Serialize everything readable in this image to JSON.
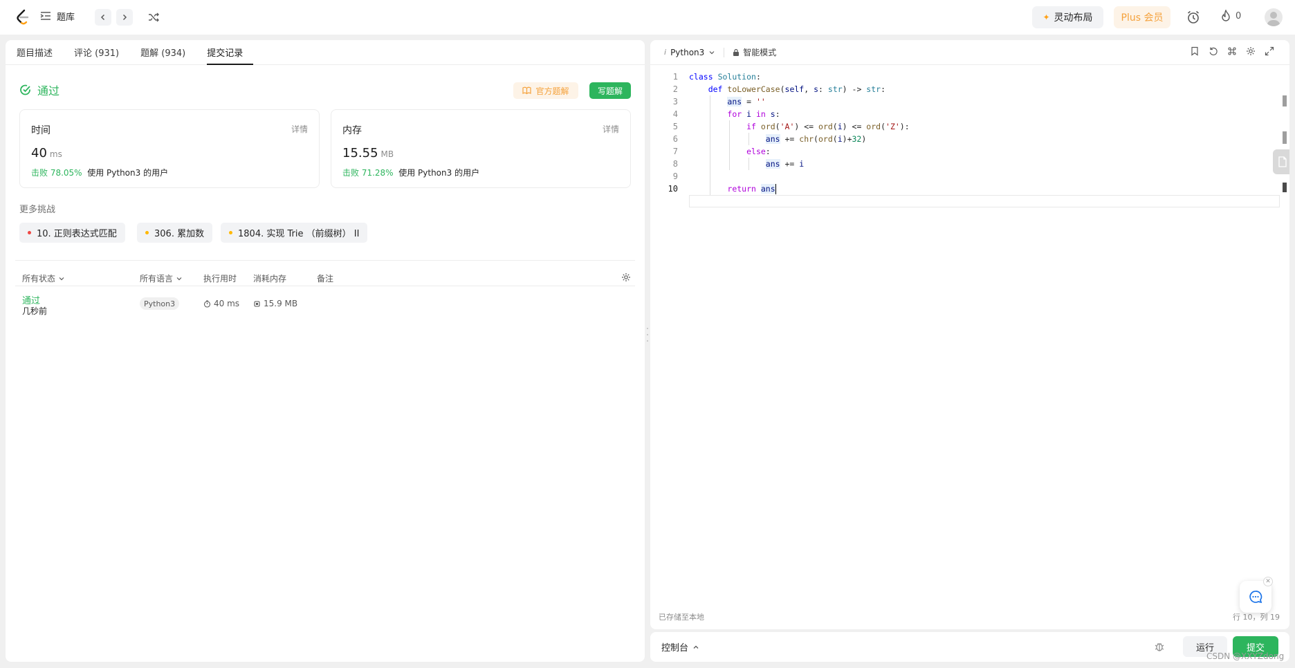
{
  "topbar": {
    "problem_bank": "题库",
    "smart_layout": "灵动布局",
    "plus": "Plus 会员",
    "streak_count": "0",
    "colors": {
      "accent_orange": "#f5a23c",
      "plus_bg": "#fdf3e7"
    }
  },
  "left": {
    "tabs": [
      "题目描述",
      "评论 (931)",
      "题解 (934)",
      "提交记录"
    ],
    "active_tab": "提交记录",
    "status": "通过",
    "official_solution": "官方题解",
    "write_solution": "写题解",
    "time_card": {
      "title": "时间",
      "detail": "详情",
      "value": "40",
      "unit": "ms",
      "beat_label": "击败 78.05%",
      "beat_suffix": "使用 Python3 的用户"
    },
    "memory_card": {
      "title": "内存",
      "detail": "详情",
      "value": "15.55",
      "unit": "MB",
      "beat_label": "击败 71.28%",
      "beat_suffix": "使用 Python3 的用户"
    },
    "more_challenges": "更多挑战",
    "challenges": [
      {
        "label": "10. 正则表达式匹配",
        "color": "#ef4743"
      },
      {
        "label": "306. 累加数",
        "color": "#ffb800"
      },
      {
        "label": "1804. 实现 Trie （前缀树） II",
        "color": "#ffb800"
      }
    ],
    "table": {
      "headers": {
        "status": "所有状态",
        "language": "所有语言",
        "runtime": "执行用时",
        "memory": "消耗内存",
        "notes": "备注"
      },
      "rows": [
        {
          "status": "通过",
          "time_ago": "几秒前",
          "language": "Python3",
          "runtime": "40 ms",
          "memory": "15.9 MB"
        }
      ]
    }
  },
  "editor": {
    "language": "Python3",
    "mode": "智能模式",
    "saved": "已存储至本地",
    "position": "行 10，列 19",
    "line_numbers": [
      "1",
      "2",
      "3",
      "4",
      "5",
      "6",
      "7",
      "8",
      "9",
      "10"
    ]
  },
  "bottom": {
    "console": "控制台",
    "run": "运行",
    "submit": "提交"
  },
  "watermark": "CSDN @XXYZdong"
}
